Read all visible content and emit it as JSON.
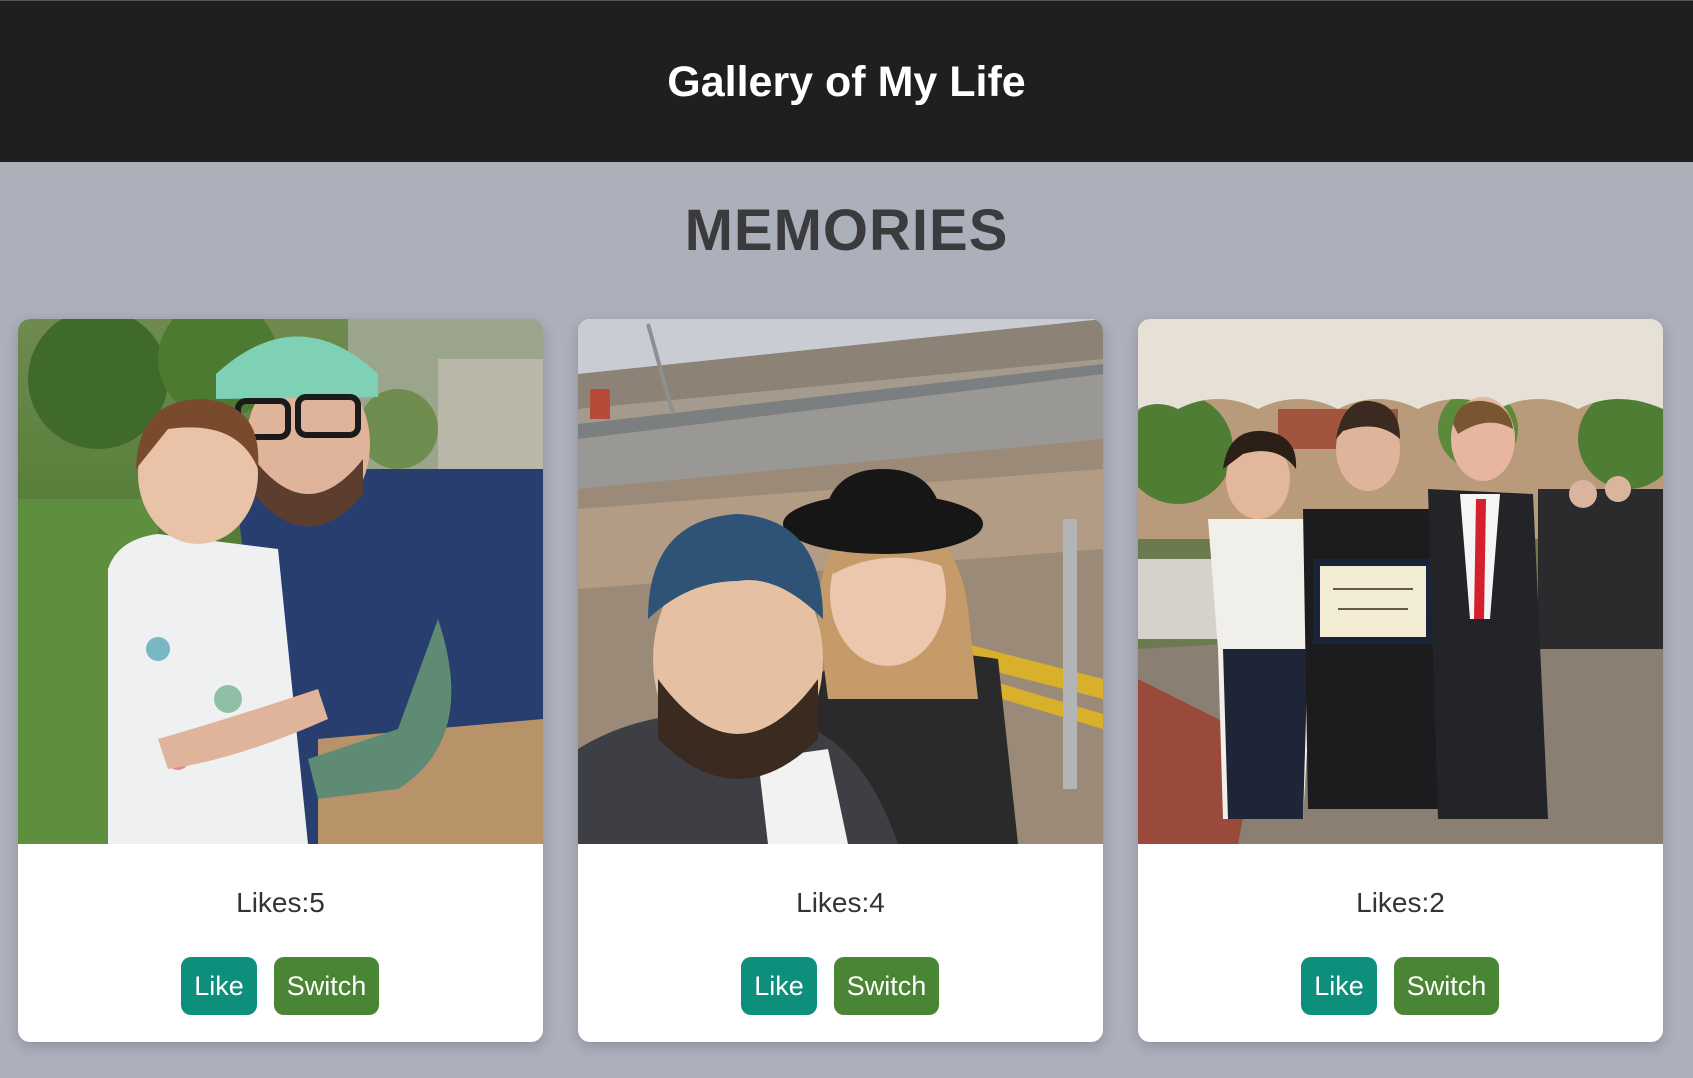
{
  "header": {
    "title": "Gallery of My Life"
  },
  "main": {
    "heading": "MEMORIES",
    "cards": [
      {
        "photo": "photo-father-daughter",
        "likes_text": "Likes:5",
        "like_label": "Like",
        "switch_label": "Switch"
      },
      {
        "photo": "photo-couple-selfie-waterfront",
        "likes_text": "Likes:4",
        "like_label": "Like",
        "switch_label": "Switch"
      },
      {
        "photo": "photo-graduation-family",
        "likes_text": "Likes:2",
        "like_label": "Like",
        "switch_label": "Switch"
      }
    ]
  },
  "colors": {
    "header_bg": "#1f1f1f",
    "page_bg": "#acb0bb",
    "like_button": "#0e8f7c",
    "switch_button": "#4a8535"
  }
}
